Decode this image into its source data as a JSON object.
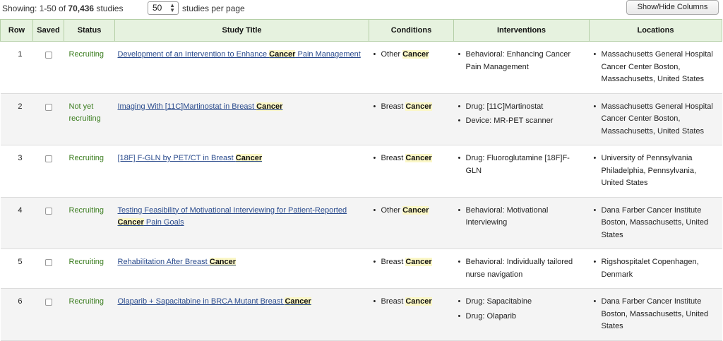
{
  "topbar": {
    "showing_prefix": "Showing: 1-50 of ",
    "total": "70,436",
    "showing_suffix": " studies",
    "per_page_value": "50",
    "per_page_label": "studies per page",
    "show_hide_label": "Show/Hide Columns"
  },
  "table": {
    "headers": [
      "Row",
      "Saved",
      "Status",
      "Study Title",
      "Conditions",
      "Interventions",
      "Locations"
    ],
    "rows": [
      {
        "row": "1",
        "status": "Recruiting",
        "title": [
          "Development of an Intervention to Enhance ",
          "Cancer",
          " Pain Management"
        ],
        "conditions": [
          [
            "Other ",
            "Cancer"
          ]
        ],
        "interventions": [
          "Behavioral: Enhancing Cancer Pain Management"
        ],
        "locations": [
          "Massachusetts General Hospital Cancer Center Boston, Massachusetts, United States"
        ]
      },
      {
        "row": "2",
        "status": "Not yet recruiting",
        "title": [
          "Imaging With [11C]Martinostat in Breast ",
          "Cancer",
          ""
        ],
        "conditions": [
          [
            "Breast ",
            "Cancer"
          ]
        ],
        "interventions": [
          "Drug: [11C]Martinostat",
          "Device: MR-PET scanner"
        ],
        "locations": [
          "Massachusetts General Hospital Cancer Center Boston, Massachusetts, United States"
        ]
      },
      {
        "row": "3",
        "status": "Recruiting",
        "title": [
          "[18F] F-GLN by PET/CT in Breast ",
          "Cancer",
          ""
        ],
        "conditions": [
          [
            "Breast ",
            "Cancer"
          ]
        ],
        "interventions": [
          "Drug: Fluoroglutamine [18F]F-GLN"
        ],
        "locations": [
          "University of Pennsylvania Philadelphia, Pennsylvania, United States"
        ]
      },
      {
        "row": "4",
        "status": "Recruiting",
        "title": [
          "Testing Feasibility of Motivational Interviewing for Patient-Reported ",
          "Cancer",
          " Pain Goals"
        ],
        "conditions": [
          [
            "Other ",
            "Cancer"
          ]
        ],
        "interventions": [
          "Behavioral: Motivational Interviewing"
        ],
        "locations": [
          "Dana Farber Cancer Institute Boston, Massachusetts, United States"
        ]
      },
      {
        "row": "5",
        "status": "Recruiting",
        "title": [
          "Rehabilitation After Breast ",
          "Cancer",
          ""
        ],
        "conditions": [
          [
            "Breast ",
            "Cancer"
          ]
        ],
        "interventions": [
          "Behavioral: Individually tailored nurse navigation"
        ],
        "locations": [
          "Rigshospitalet Copenhagen, Denmark"
        ]
      },
      {
        "row": "6",
        "status": "Recruiting",
        "title": [
          "Olaparib + Sapacitabine in BRCA Mutant Breast ",
          "Cancer",
          ""
        ],
        "conditions": [
          [
            "Breast ",
            "Cancer"
          ]
        ],
        "interventions": [
          "Drug: Sapacitabine",
          "Drug: Olaparib"
        ],
        "locations": [
          "Dana Farber Cancer Institute Boston, Massachusetts, United States"
        ]
      }
    ]
  }
}
